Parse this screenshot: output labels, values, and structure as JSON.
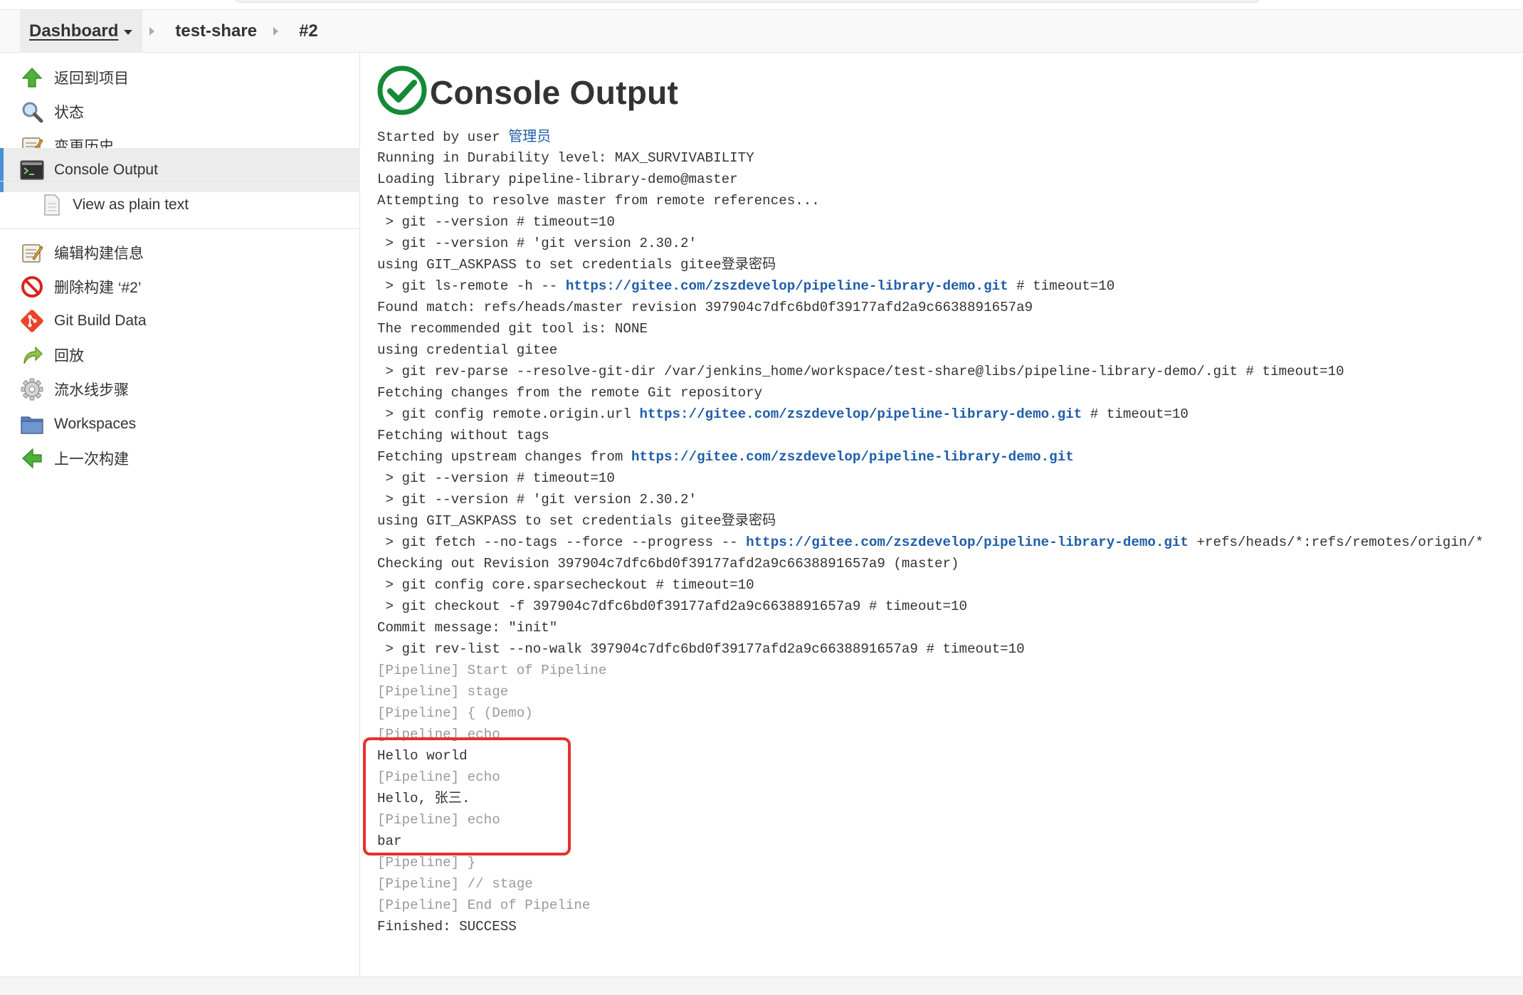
{
  "breadcrumb": {
    "items": [
      {
        "label": "Dashboard"
      },
      {
        "label": "test-share"
      },
      {
        "label": "#2"
      }
    ]
  },
  "sidebar": {
    "items": [
      {
        "label": "返回到项目",
        "icon": "up-arrow-icon"
      },
      {
        "label": "状态",
        "icon": "magnifier-icon"
      },
      {
        "label": "变更历史",
        "icon": "notepad-icon"
      },
      {
        "label": "Console Output",
        "icon": "terminal-icon",
        "active": true
      },
      {
        "label": "View as plain text",
        "icon": "document-icon"
      },
      {
        "label": "编辑构建信息",
        "icon": "notepad-icon"
      },
      {
        "label": "删除构建 ‘#2’",
        "icon": "no-entry-icon"
      },
      {
        "label": "Git Build Data",
        "icon": "git-icon"
      },
      {
        "label": "回放",
        "icon": "replay-arrow-icon"
      },
      {
        "label": "流水线步骤",
        "icon": "gear-icon"
      },
      {
        "label": "Workspaces",
        "icon": "folder-icon"
      },
      {
        "label": "上一次构建",
        "icon": "left-arrow-icon"
      }
    ]
  },
  "main": {
    "title": "Console Output",
    "status_icon": "success-check-icon",
    "colors": {
      "success": "#138a36",
      "link": "#1e5ea8",
      "highlight": "#e5312a",
      "active_accent": "#4a90d9"
    },
    "console": [
      {
        "segments": [
          {
            "text": "Started by user "
          },
          {
            "text": "管理员",
            "link": true,
            "user": true
          }
        ]
      },
      {
        "segments": [
          {
            "text": "Running in Durability level: MAX_SURVIVABILITY"
          }
        ]
      },
      {
        "segments": [
          {
            "text": "Loading library pipeline-library-demo@master"
          }
        ]
      },
      {
        "segments": [
          {
            "text": "Attempting to resolve master from remote references..."
          }
        ]
      },
      {
        "segments": [
          {
            "text": " > git --version # timeout=10"
          }
        ]
      },
      {
        "segments": [
          {
            "text": " > git --version # 'git version 2.30.2'"
          }
        ]
      },
      {
        "segments": [
          {
            "text": "using GIT_ASKPASS to set credentials gitee登录密码"
          }
        ]
      },
      {
        "segments": [
          {
            "text": " > git ls-remote -h -- "
          },
          {
            "text": "https://gitee.com/zszdevelop/pipeline-library-demo.git",
            "link": true
          },
          {
            "text": " # timeout=10"
          }
        ]
      },
      {
        "segments": [
          {
            "text": "Found match: refs/heads/master revision 397904c7dfc6bd0f39177afd2a9c6638891657a9"
          }
        ]
      },
      {
        "segments": [
          {
            "text": "The recommended git tool is: NONE"
          }
        ]
      },
      {
        "segments": [
          {
            "text": "using credential gitee"
          }
        ]
      },
      {
        "segments": [
          {
            "text": " > git rev-parse --resolve-git-dir /var/jenkins_home/workspace/test-share@libs/pipeline-library-demo/.git # timeout=10"
          }
        ]
      },
      {
        "segments": [
          {
            "text": "Fetching changes from the remote Git repository"
          }
        ]
      },
      {
        "segments": [
          {
            "text": " > git config remote.origin.url "
          },
          {
            "text": "https://gitee.com/zszdevelop/pipeline-library-demo.git",
            "link": true
          },
          {
            "text": " # timeout=10"
          }
        ]
      },
      {
        "segments": [
          {
            "text": "Fetching without tags"
          }
        ]
      },
      {
        "segments": [
          {
            "text": "Fetching upstream changes from "
          },
          {
            "text": "https://gitee.com/zszdevelop/pipeline-library-demo.git",
            "link": true
          }
        ]
      },
      {
        "segments": [
          {
            "text": " > git --version # timeout=10"
          }
        ]
      },
      {
        "segments": [
          {
            "text": " > git --version # 'git version 2.30.2'"
          }
        ]
      },
      {
        "segments": [
          {
            "text": "using GIT_ASKPASS to set credentials gitee登录密码"
          }
        ]
      },
      {
        "segments": [
          {
            "text": " > git fetch --no-tags --force --progress -- "
          },
          {
            "text": "https://gitee.com/zszdevelop/pipeline-library-demo.git",
            "link": true
          },
          {
            "text": " +refs/heads/*:refs/remotes/origin/*"
          }
        ]
      },
      {
        "segments": [
          {
            "text": "Checking out Revision 397904c7dfc6bd0f39177afd2a9c6638891657a9 (master)"
          }
        ]
      },
      {
        "segments": [
          {
            "text": " > git config core.sparsecheckout # timeout=10"
          }
        ]
      },
      {
        "segments": [
          {
            "text": " > git checkout -f 397904c7dfc6bd0f39177afd2a9c6638891657a9 # timeout=10"
          }
        ]
      },
      {
        "segments": [
          {
            "text": "Commit message: \"init\""
          }
        ]
      },
      {
        "segments": [
          {
            "text": " > git rev-list --no-walk 397904c7dfc6bd0f39177afd2a9c6638891657a9 # timeout=10"
          }
        ]
      },
      {
        "pipeline": true,
        "segments": [
          {
            "text": "[Pipeline] Start of Pipeline"
          }
        ]
      },
      {
        "pipeline": true,
        "segments": [
          {
            "text": "[Pipeline] stage"
          }
        ]
      },
      {
        "pipeline": true,
        "segments": [
          {
            "text": "[Pipeline] { (Demo)"
          }
        ]
      },
      {
        "pipeline": true,
        "segments": [
          {
            "text": "[Pipeline] echo"
          }
        ]
      },
      {
        "segments": [
          {
            "text": "Hello world"
          }
        ]
      },
      {
        "pipeline": true,
        "segments": [
          {
            "text": "[Pipeline] echo"
          }
        ]
      },
      {
        "segments": [
          {
            "text": "Hello, 张三."
          }
        ]
      },
      {
        "pipeline": true,
        "segments": [
          {
            "text": "[Pipeline] echo"
          }
        ]
      },
      {
        "segments": [
          {
            "text": "bar"
          }
        ]
      },
      {
        "pipeline": true,
        "segments": [
          {
            "text": "[Pipeline] }"
          }
        ]
      },
      {
        "pipeline": true,
        "segments": [
          {
            "text": "[Pipeline] // stage"
          }
        ]
      },
      {
        "pipeline": true,
        "segments": [
          {
            "text": "[Pipeline] End of Pipeline"
          }
        ]
      },
      {
        "segments": [
          {
            "text": "Finished: SUCCESS"
          }
        ]
      }
    ]
  }
}
